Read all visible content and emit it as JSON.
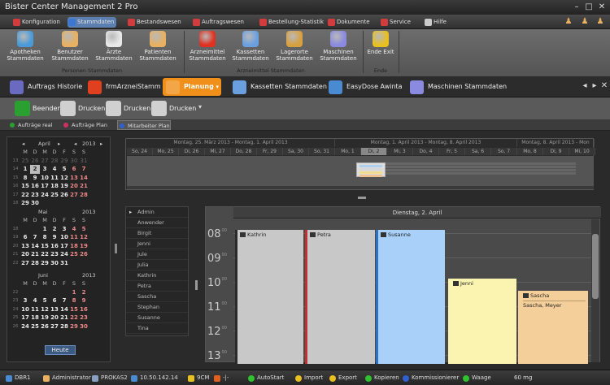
{
  "window": {
    "title": "Bister Center Management 2 Pro"
  },
  "menu": {
    "items": [
      {
        "label": "Konfiguration",
        "color": "#d23c3c"
      },
      {
        "label": "Stammdaten",
        "color": "#3c78d2"
      },
      {
        "label": "Bestandswesen",
        "color": "#d23c3c"
      },
      {
        "label": "Auftragswesen",
        "color": "#d23c3c"
      },
      {
        "label": "Bestellung-Statistik",
        "color": "#d23c3c"
      },
      {
        "label": "Dokumente",
        "color": "#d23c3c"
      },
      {
        "label": "Service",
        "color": "#d23c3c"
      },
      {
        "label": "Hilfe",
        "color": "#cccccc"
      }
    ]
  },
  "ribbon": {
    "buttons": [
      {
        "label1": "Apotheken",
        "label2": "Stammdaten",
        "color": "#4a9ad8"
      },
      {
        "label1": "Benutzer",
        "label2": "Stammdaten",
        "color": "#e8b060"
      },
      {
        "label1": "Ärzte",
        "label2": "Stammdaten",
        "color": "#e8e8e8"
      },
      {
        "label1": "Patienten",
        "label2": "Stammdaten",
        "color": "#e8b060"
      },
      {
        "label1": "Arzneimittel",
        "label2": "Stammdaten",
        "color": "#e03020"
      },
      {
        "label1": "Kassetten",
        "label2": "Stammdaten",
        "color": "#6aa0e0"
      },
      {
        "label1": "Lagerorte",
        "label2": "Stammdaten",
        "color": "#d9a040"
      },
      {
        "label1": "Maschinen",
        "label2": "Stammdaten",
        "color": "#8a8ae0"
      },
      {
        "label1": "Ende Exit",
        "label2": "",
        "color": "#e8c020"
      }
    ],
    "groups": [
      "Personen Stammdaten",
      "Arzneimittel Stammdaten",
      "Ende"
    ]
  },
  "doc_tabs": [
    {
      "label": "Auftrags Historie",
      "color": "#6a6ac0"
    },
    {
      "label": "frmArzneiStamm",
      "color": "#e04020"
    },
    {
      "label": "Planung",
      "color": "#f0901a"
    },
    {
      "label": "Kassetten Stammdaten",
      "color": "#6aa0e0"
    },
    {
      "label": "EasyDose Awinta",
      "color": "#4a8ad0"
    },
    {
      "label": "Maschinen Stammdaten",
      "color": "#8a8ae0"
    }
  ],
  "toolbar": {
    "buttons": [
      {
        "label": "Beenden",
        "color": "#2aa030"
      },
      {
        "label": "Drucken",
        "color": "#d0d0d0"
      },
      {
        "label": "Drucken",
        "color": "#d0d0d0"
      },
      {
        "label": "Drucken",
        "color": "#d0d0d0"
      }
    ]
  },
  "sub_tabs": [
    {
      "label": "Aufträge real",
      "color": "#2aa030"
    },
    {
      "label": "Aufträge Plan",
      "color": "#d03060"
    },
    {
      "label": "Mitarbeiter Plan",
      "color": "#3060d0"
    }
  ],
  "calendars": [
    {
      "month": "April",
      "year": "2013",
      "days": [
        "M",
        "D",
        "M",
        "D",
        "F",
        "S",
        "S"
      ],
      "rows": [
        {
          "wk": "13",
          "d": [
            "25",
            "26",
            "27",
            "28",
            "29",
            "30",
            "31"
          ],
          "oth": [
            0,
            1,
            2,
            3,
            4,
            5,
            6
          ]
        },
        {
          "wk": "14",
          "d": [
            "1",
            "2",
            "3",
            "4",
            "5",
            "6",
            "7"
          ]
        },
        {
          "wk": "15",
          "d": [
            "8",
            "9",
            "10",
            "11",
            "12",
            "13",
            "14"
          ]
        },
        {
          "wk": "16",
          "d": [
            "15",
            "16",
            "17",
            "18",
            "19",
            "20",
            "21"
          ]
        },
        {
          "wk": "17",
          "d": [
            "22",
            "23",
            "24",
            "25",
            "26",
            "27",
            "28"
          ]
        },
        {
          "wk": "18",
          "d": [
            "29",
            "30",
            "",
            "",
            "",
            "",
            ""
          ]
        }
      ]
    },
    {
      "month": "Mai",
      "year": "2013",
      "days": [
        "M",
        "D",
        "M",
        "D",
        "F",
        "S",
        "S"
      ],
      "rows": [
        {
          "wk": "18",
          "d": [
            "",
            "",
            "1",
            "2",
            "3",
            "4",
            "5"
          ]
        },
        {
          "wk": "19",
          "d": [
            "6",
            "7",
            "8",
            "9",
            "10",
            "11",
            "12"
          ]
        },
        {
          "wk": "20",
          "d": [
            "13",
            "14",
            "15",
            "16",
            "17",
            "18",
            "19"
          ]
        },
        {
          "wk": "21",
          "d": [
            "20",
            "21",
            "22",
            "23",
            "24",
            "25",
            "26"
          ]
        },
        {
          "wk": "22",
          "d": [
            "27",
            "28",
            "29",
            "30",
            "31",
            "",
            ""
          ]
        }
      ]
    },
    {
      "month": "Juni",
      "year": "2013",
      "days": [
        "M",
        "D",
        "M",
        "D",
        "F",
        "S",
        "S"
      ],
      "rows": [
        {
          "wk": "22",
          "d": [
            "",
            "",
            "",
            "",
            "",
            "1",
            "2"
          ]
        },
        {
          "wk": "23",
          "d": [
            "3",
            "4",
            "5",
            "6",
            "7",
            "8",
            "9"
          ]
        },
        {
          "wk": "24",
          "d": [
            "10",
            "11",
            "12",
            "13",
            "14",
            "15",
            "16"
          ]
        },
        {
          "wk": "25",
          "d": [
            "17",
            "18",
            "19",
            "20",
            "21",
            "22",
            "23"
          ]
        },
        {
          "wk": "26",
          "d": [
            "24",
            "25",
            "26",
            "27",
            "28",
            "29",
            "30"
          ]
        }
      ]
    }
  ],
  "heute_label": "Heute",
  "overview": {
    "weeks": [
      "Montag, 25. März 2013 - Montag, 1. April 2013",
      "Montag, 1. April 2013 - Montag, 8. April 2013",
      "Montag, 8. April 2013 - Mon"
    ],
    "days": [
      "So, 24",
      "Mo, 25",
      "Di, 26",
      "Mi, 27",
      "Do, 28",
      "Fr, 29",
      "Sa, 30",
      "So, 31",
      "Mo, 1",
      "Di, 2",
      "Mi, 3",
      "Do, 4",
      "Fr, 5",
      "Sa, 6",
      "So, 7",
      "Mo, 8",
      "Di, 9",
      "Mi, 10"
    ]
  },
  "resources": [
    "Admin",
    "Anwender",
    "Birgit",
    "Jenni",
    "Jule",
    "Julia",
    "Kathrin",
    "Petra",
    "Sascha",
    "Stephan",
    "Susanne",
    "Tina"
  ],
  "dayview": {
    "date": "Dienstag, 2. April",
    "hours": [
      "08",
      "09",
      "10",
      "11",
      "12",
      "13"
    ],
    "minutes": "00",
    "appointments": [
      {
        "name": "Kathrin",
        "sub": "",
        "bg": "#c8c8c8",
        "bar": "#2a2a2a"
      },
      {
        "name": "Petra",
        "sub": "",
        "bg": "#c8c8c8",
        "bar": "#c03030"
      },
      {
        "name": "Susanne",
        "sub": "",
        "bg": "#a8d0f8",
        "bar": "#3070c0"
      },
      {
        "name": "Jenni",
        "sub": "",
        "bg": "#fbf3b0",
        "bar": "#fbf3b0"
      },
      {
        "name": "Sascha",
        "sub": "Sascha, Meyer",
        "bg": "#f5cf9a",
        "bar": "#f5cf9a"
      }
    ]
  },
  "status": {
    "items": [
      {
        "label": "DBR1",
        "color": "#4a8ad0"
      },
      {
        "label": "Administrator",
        "color": "#e8b060"
      },
      {
        "label": "PROKAS2",
        "color": "#8aa0c0"
      },
      {
        "label": "10.50.142.14",
        "color": "#4a8ad0"
      },
      {
        "label": "9CM",
        "color": "#e8c020"
      },
      {
        "label": "-|-",
        "color": "#e06020"
      },
      {
        "label": "AutoStart",
        "color": "#30c030"
      },
      {
        "label": "Import",
        "color": "#e8c020"
      },
      {
        "label": "Export",
        "color": "#e8c020"
      },
      {
        "label": "Kopieren",
        "color": "#30c030"
      },
      {
        "label": "Kommissionierer",
        "color": "#3060d0"
      },
      {
        "label": "Waage",
        "color": "#30c030"
      },
      {
        "label": "60 mg",
        "color": ""
      }
    ]
  }
}
